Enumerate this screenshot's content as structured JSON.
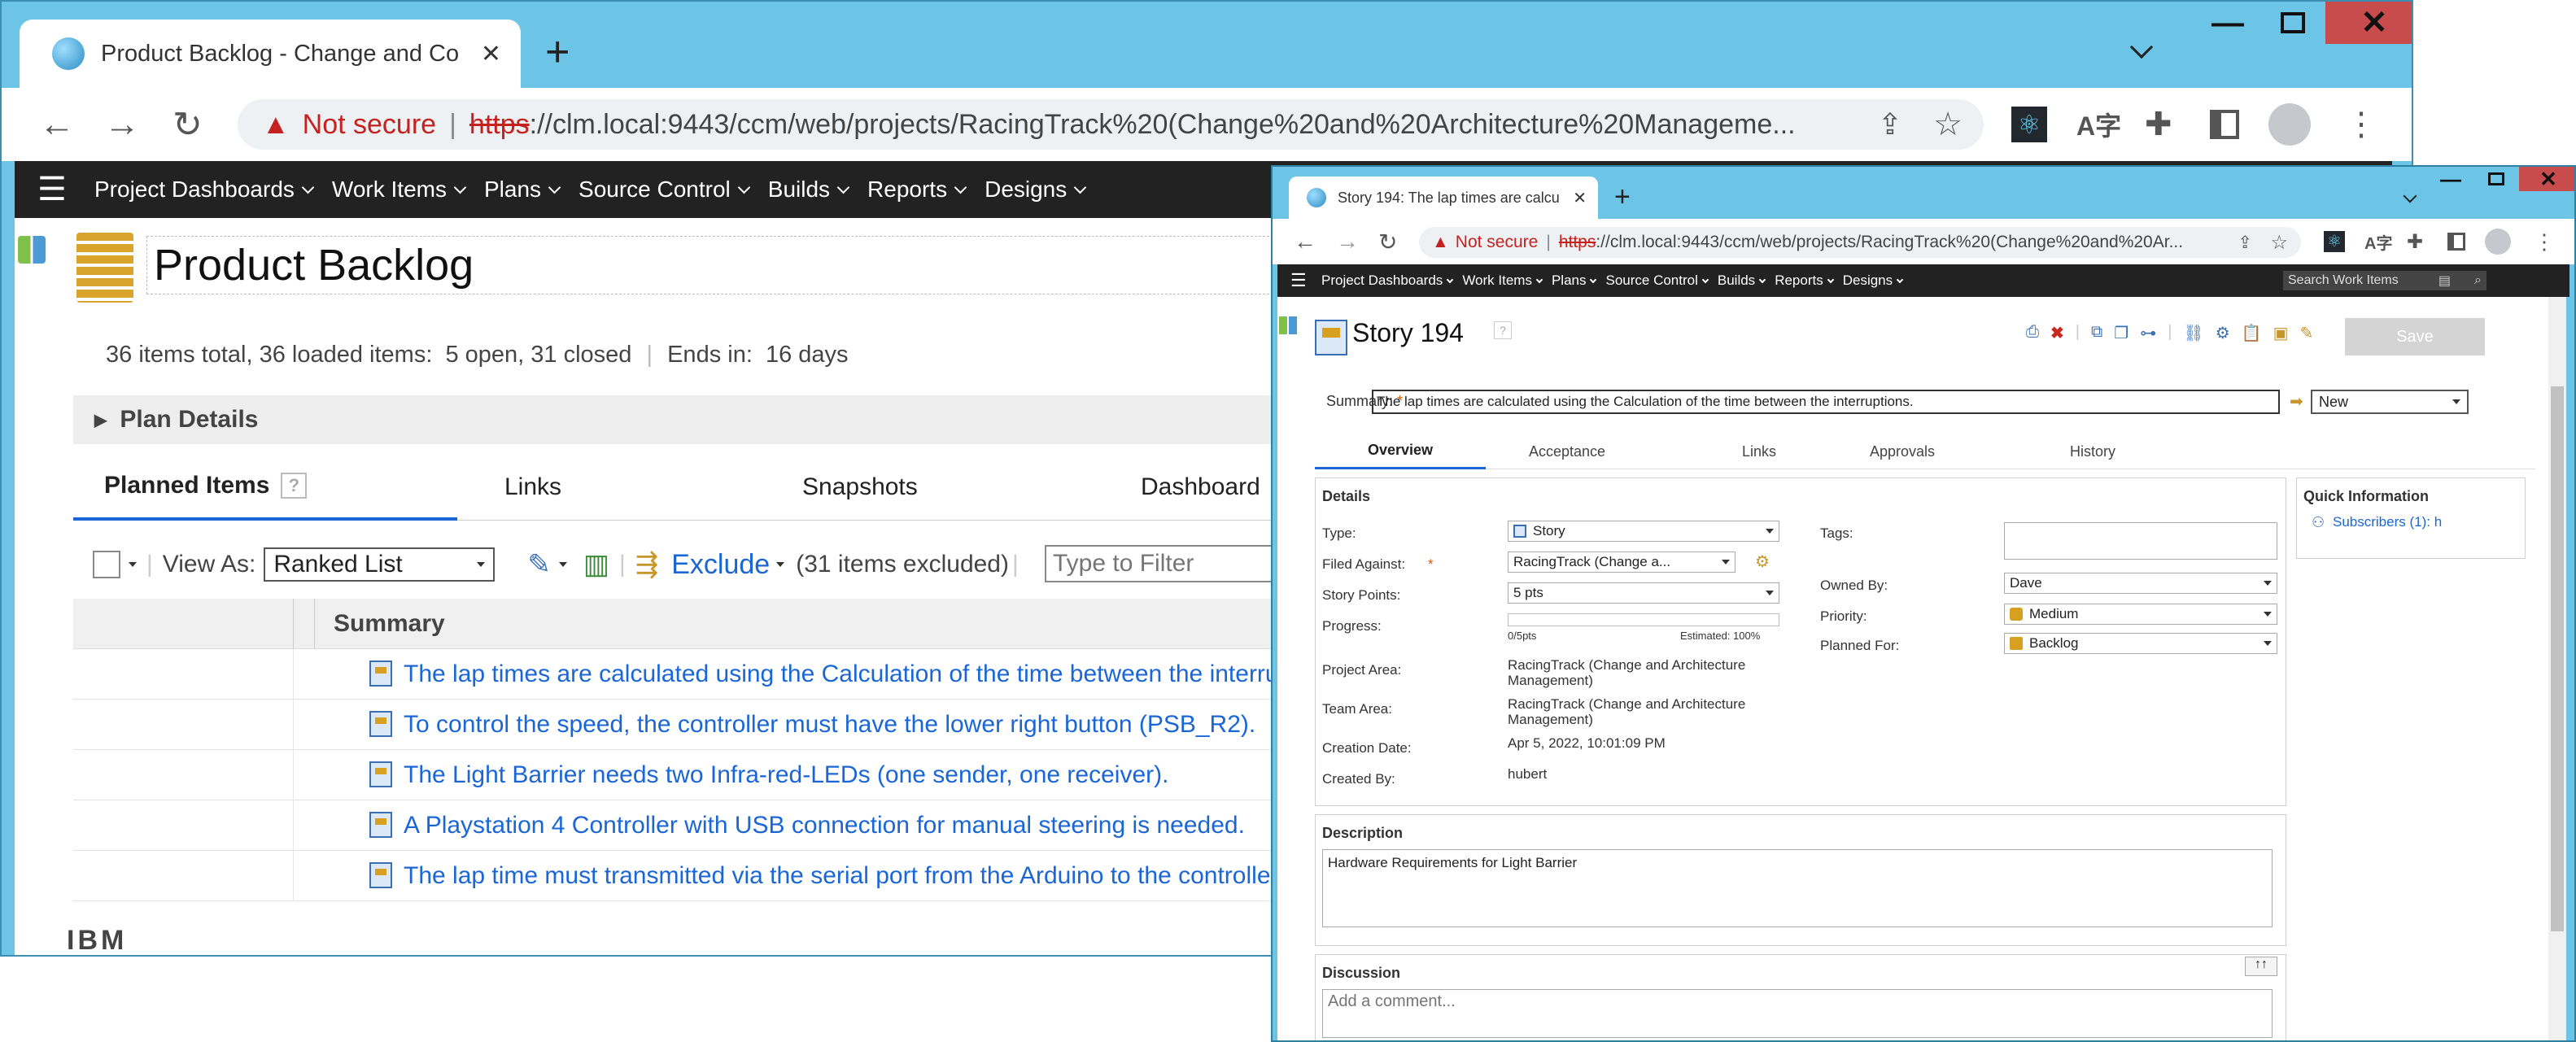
{
  "main_window": {
    "tab_title": "Product Backlog - Change and Co",
    "new_tab": "+",
    "tabs_dropdown": "⌄",
    "not_secure": "Not secure",
    "url_scheme": "https",
    "url_rest": "://clm.local:9443/ccm/web/projects/RacingTrack%20(Change%20and%20Architecture%20Manageme...",
    "nav": [
      "Project Dashboards",
      "Work Items",
      "Plans",
      "Source Control",
      "Builds",
      "Reports",
      "Designs"
    ],
    "page_title": "Product Backlog",
    "summary_line": {
      "total": "36 items total, 36 loaded items:",
      "open": "5 open, 31 closed",
      "ends_label": "Ends in:",
      "ends_value": "16 days"
    },
    "plan_details": "Plan Details",
    "tabs": [
      "Planned Items",
      "Links",
      "Snapshots",
      "Dashboard"
    ],
    "toolbar": {
      "view_as_label": "View As:",
      "view_as_value": "Ranked List",
      "exclude": "Exclude",
      "excluded": "(31 items excluded)",
      "filter_placeholder": "Type to Filter"
    },
    "column_header": "Summary",
    "items": [
      "The lap times are calculated using the Calculation of the time between the interru",
      "To control the speed, the controller must have the lower right button (PSB_R2).",
      "The Light Barrier needs two Infra-red-LEDs (one sender, one receiver).",
      "A Playstation 4 Controller with USB connection for manual steering is needed.",
      "The lap time must transmitted via the serial port from the Arduino to the controller"
    ],
    "footer_logo": "IBM"
  },
  "popup_window": {
    "tab_title": "Story 194: The lap times are calcu",
    "not_secure": "Not secure",
    "url_scheme": "https",
    "url_rest": "://clm.local:9443/ccm/web/projects/RacingTrack%20(Change%20and%20Ar...",
    "nav": [
      "Project Dashboards",
      "Work Items",
      "Plans",
      "Source Control",
      "Builds",
      "Reports",
      "Designs"
    ],
    "search_placeholder": "Search Work Items",
    "story_title": "Story 194",
    "save_label": "Save",
    "summary_label": "Summary:",
    "summary_value": "The lap times are calculated using the Calculation of the time between the interruptions.",
    "state_value": "New",
    "tabs": [
      "Overview",
      "Acceptance",
      "Links",
      "Approvals",
      "History"
    ],
    "details_header": "Details",
    "fields": {
      "type_label": "Type:",
      "type_value": "Story",
      "filed_label": "Filed Against:",
      "filed_value": "RacingTrack (Change a...",
      "points_label": "Story Points:",
      "points_value": "5 pts",
      "progress_label": "Progress:",
      "progress_left": "0/5pts",
      "progress_right": "Estimated: 100%",
      "progress_fraction": 0,
      "project_label": "Project Area:",
      "project_value": "RacingTrack (Change and Architecture Management)",
      "team_label": "Team Area:",
      "team_value": "RacingTrack (Change and Architecture Management)",
      "created_label": "Creation Date:",
      "created_value": "Apr 5, 2022, 10:01:09 PM",
      "createdby_label": "Created By:",
      "createdby_value": "hubert",
      "tags_label": "Tags:",
      "owned_label": "Owned By:",
      "owned_value": "Dave",
      "priority_label": "Priority:",
      "priority_value": "Medium",
      "planned_label": "Planned For:",
      "planned_value": "Backlog"
    },
    "quick_info_header": "Quick Information",
    "subscribers": "Subscribers (1): h",
    "description_header": "Description",
    "description_value": "Hardware Requirements for Light Barrier",
    "discussion_header": "Discussion",
    "comment_placeholder": "Add a comment..."
  },
  "colors": {
    "chrome": "#6cc5e6",
    "nav": "#222222",
    "link": "#1a66d6",
    "close": "#c94c4c"
  }
}
